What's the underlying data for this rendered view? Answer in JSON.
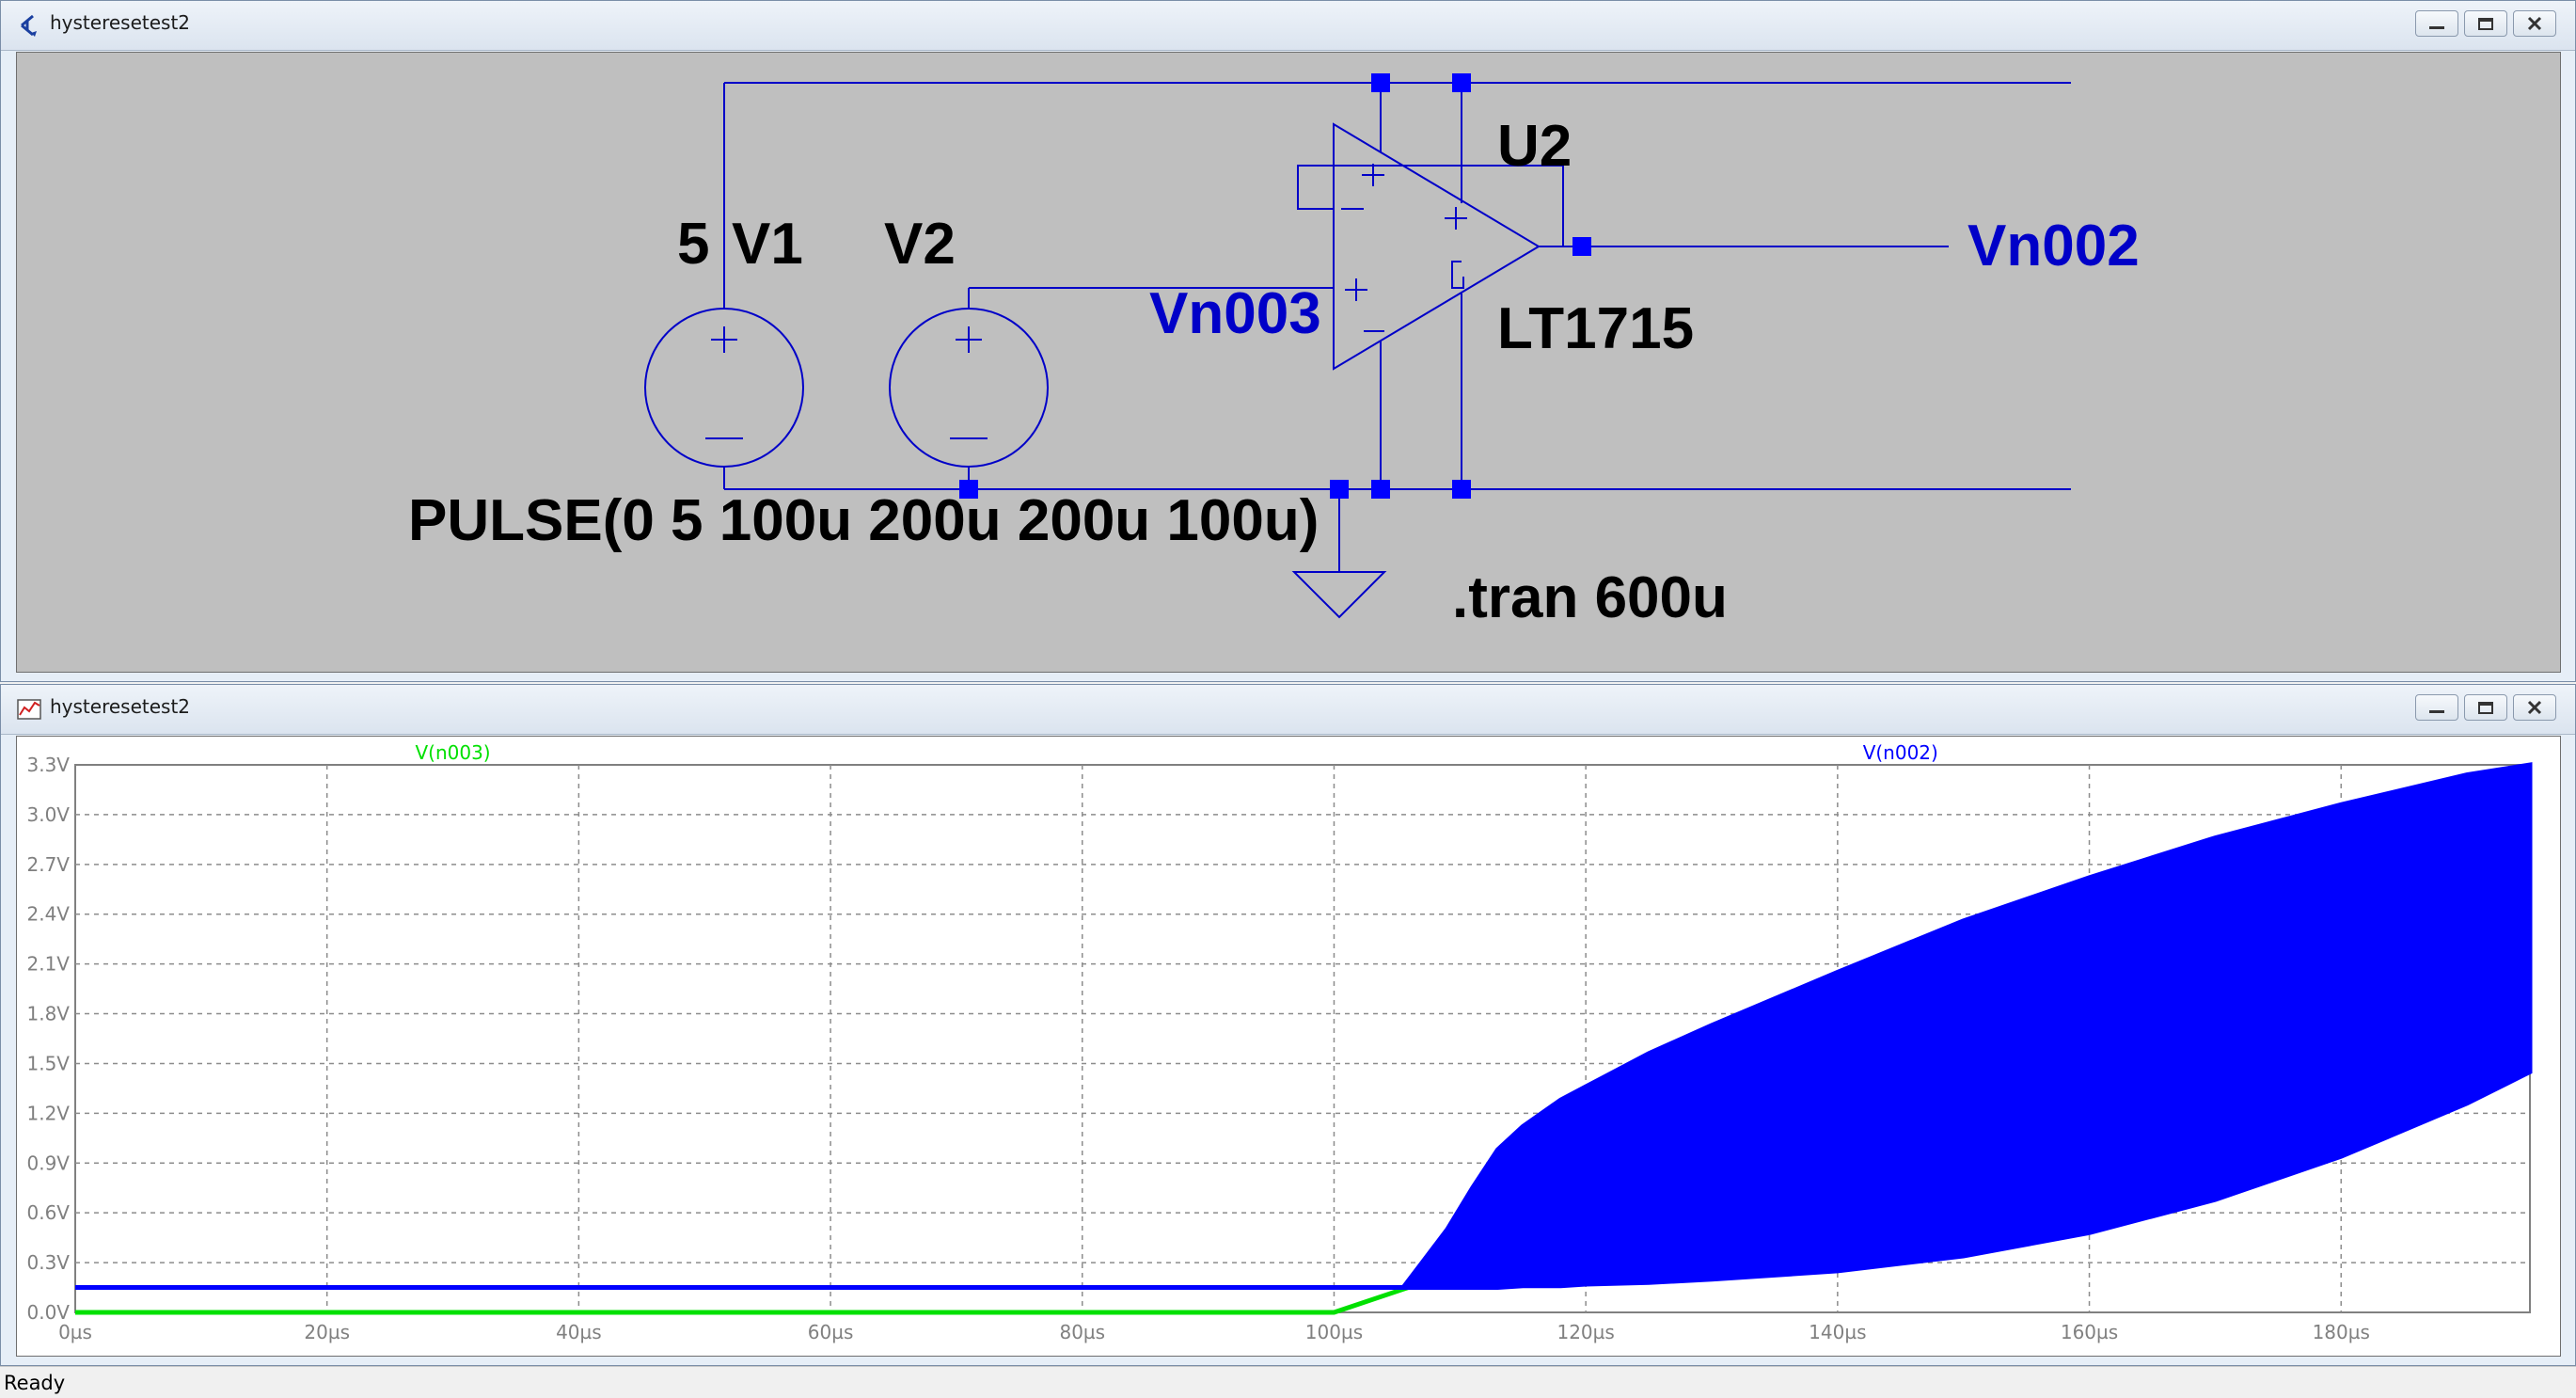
{
  "schematic_window": {
    "title": "hysteresetest2"
  },
  "schematic": {
    "labels": {
      "v1_value": "5",
      "v1_name": "V1",
      "v2_name": "V2",
      "u2_name": "U2",
      "u2_part": "LT1715",
      "net_n003": "Vn003",
      "net_n002": "Vn002",
      "pulse_spec": "PULSE(0 5 100u 200u 200u 100u)",
      "tran_directive": ".tran 600u"
    },
    "colors": {
      "background": "#bfbfbf",
      "wire": "#0000c8",
      "junction": "#0000ff",
      "text": "#000000",
      "net_label": "#0000c8"
    }
  },
  "plot_window": {
    "title": "hysteresetest2"
  },
  "chart_data": {
    "type": "line",
    "title": "",
    "xlabel": "",
    "ylabel": "",
    "xlim": [
      0,
      195
    ],
    "ylim": [
      0,
      3.3
    ],
    "x_unit": "µs",
    "y_unit": "V",
    "grid": true,
    "x_ticks": [
      0,
      20,
      40,
      60,
      80,
      100,
      120,
      140,
      160,
      180
    ],
    "x_tick_labels": [
      "0µs",
      "20µs",
      "40µs",
      "60µs",
      "80µs",
      "100µs",
      "120µs",
      "140µs",
      "160µs",
      "180µs"
    ],
    "y_ticks": [
      0.0,
      0.3,
      0.6,
      0.9,
      1.2,
      1.5,
      1.8,
      2.1,
      2.4,
      2.7,
      3.0,
      3.3
    ],
    "y_tick_labels": [
      "0.0V",
      "0.3V",
      "0.6V",
      "0.9V",
      "1.2V",
      "1.5V",
      "1.8V",
      "2.1V",
      "2.4V",
      "2.7V",
      "3.0V",
      "3.3V"
    ],
    "series": [
      {
        "name": "V(n003)",
        "color": "#00e000",
        "style": "line",
        "x": [
          0,
          100,
          105.5,
          195
        ],
        "y": [
          0,
          0,
          0.14,
          2.35
        ]
      },
      {
        "name": "V(n002)",
        "color": "#0000ff",
        "style": "band",
        "x": [
          0,
          105.5,
          107,
          109,
          111,
          113,
          115,
          118,
          120,
          125,
          130,
          140,
          150,
          160,
          170,
          180,
          190,
          195
        ],
        "y_low": [
          0.15,
          0.15,
          0.15,
          0.15,
          0.15,
          0.15,
          0.16,
          0.16,
          0.17,
          0.18,
          0.2,
          0.25,
          0.34,
          0.48,
          0.68,
          0.94,
          1.26,
          1.45
        ],
        "y_high": [
          0.15,
          0.15,
          0.3,
          0.5,
          0.75,
          0.98,
          1.12,
          1.28,
          1.36,
          1.56,
          1.73,
          2.05,
          2.36,
          2.62,
          2.86,
          3.06,
          3.24,
          3.3
        ]
      }
    ]
  },
  "status": {
    "text": "Ready"
  }
}
